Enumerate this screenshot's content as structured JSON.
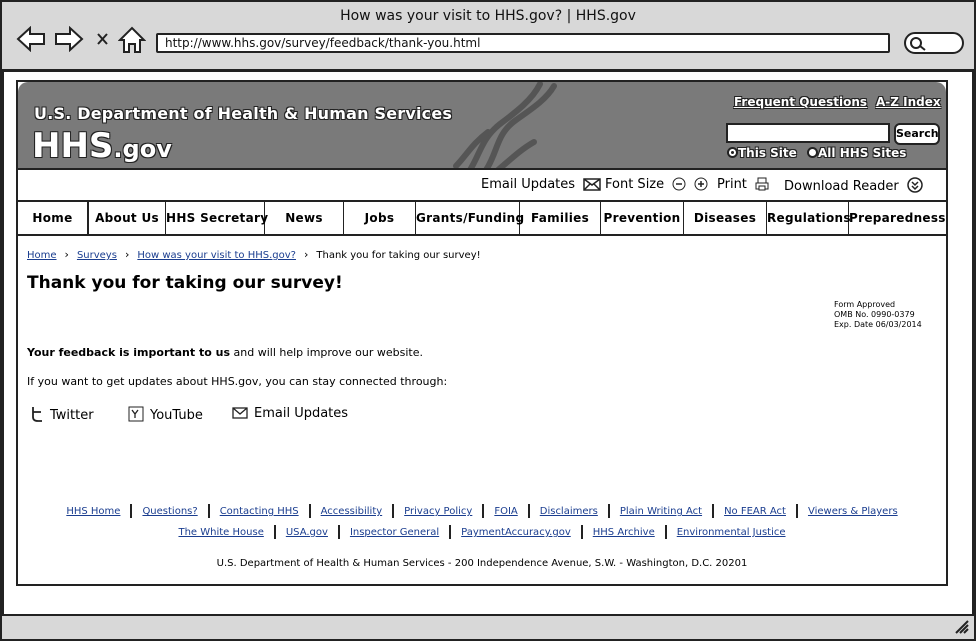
{
  "browser": {
    "window_title": "How was your visit to HHS.gov? | HHS.gov",
    "url": "http://www.hhs.gov/survey/feedback/thank-you.html"
  },
  "header": {
    "department": "U.S. Department of Health & Human Services",
    "logo_main": "HHS",
    "logo_suffix": ".gov",
    "frequent_questions": "Frequent Questions",
    "az_index": "A-Z Index",
    "search_button": "Search",
    "radio_this_site": "This Site",
    "radio_all_sites": "All HHS Sites"
  },
  "utility": {
    "email_updates": "Email Updates",
    "font_size": "Font Size",
    "print": "Print",
    "download_reader": "Download Reader"
  },
  "nav": [
    "Home",
    "About Us",
    "HHS Secretary",
    "News",
    "Jobs",
    "Grants/Funding",
    "Families",
    "Prevention",
    "Diseases",
    "Regulations",
    "Preparedness"
  ],
  "breadcrumb": {
    "home": "Home",
    "surveys": "Surveys",
    "visit": "How was your visit to HHS.gov?",
    "current": "Thank you for taking our survey!"
  },
  "page_title": "Thank you for taking our survey!",
  "omb": {
    "line1": "Form Approved",
    "line2": "OMB No. 0990-0379",
    "line3": "Exp. Date 06/03/2014"
  },
  "content": {
    "p1_bold": "Your feedback is important to us",
    "p1_rest": " and will help improve our website.",
    "p2": "If you want to get updates about HHS.gov, you can stay connected through:"
  },
  "social": {
    "twitter": "Twitter",
    "youtube": "YouTube",
    "email": "Email Updates"
  },
  "footer": {
    "row1": [
      "HHS Home",
      "Questions?",
      "Contacting HHS",
      "Accessibility",
      "Privacy Policy",
      "FOIA",
      "Disclaimers",
      "Plain Writing Act",
      "No FEAR Act",
      "Viewers & Players"
    ],
    "row2": [
      "The White House",
      "USA.gov",
      "Inspector General",
      "PaymentAccuracy.gov",
      "HHS Archive",
      "Environmental Justice"
    ],
    "address": "U.S. Department of Health & Human Services - 200 Independence Avenue, S.W. - Washington, D.C. 20201"
  }
}
